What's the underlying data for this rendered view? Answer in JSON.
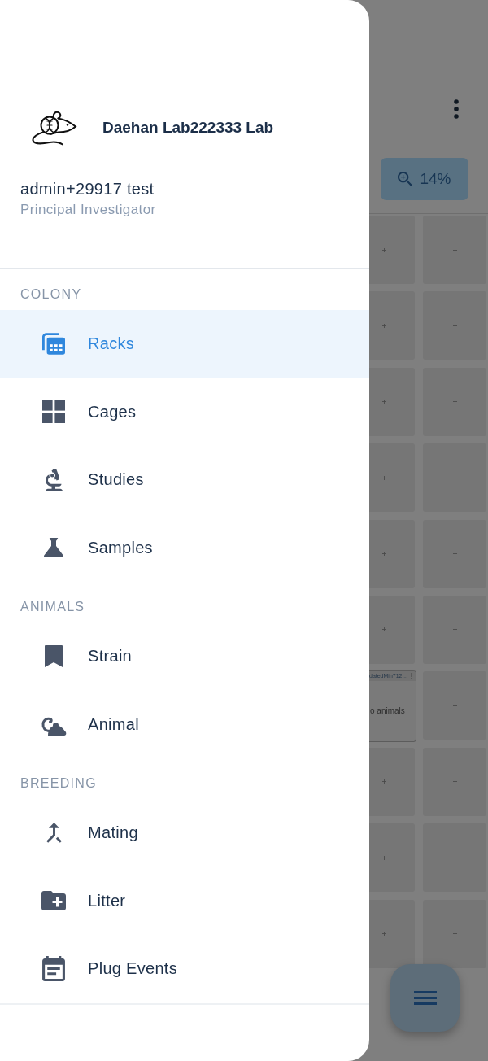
{
  "drawer": {
    "lab_name": "Daehan Lab222333 Lab",
    "user": {
      "name": "admin+29917 test",
      "role": "Principal Investigator"
    },
    "sections": [
      {
        "title": "COLONY",
        "items": [
          {
            "label": "Racks",
            "selected": true
          },
          {
            "label": "Cages",
            "selected": false
          },
          {
            "label": "Studies",
            "selected": false
          },
          {
            "label": "Samples",
            "selected": false
          }
        ]
      },
      {
        "title": "ANIMALS",
        "items": [
          {
            "label": "Strain",
            "selected": false
          },
          {
            "label": "Animal",
            "selected": false
          }
        ]
      },
      {
        "title": "BREEDING",
        "items": [
          {
            "label": "Mating",
            "selected": false
          },
          {
            "label": "Litter",
            "selected": false
          },
          {
            "label": "Plug Events",
            "selected": false
          }
        ]
      }
    ]
  },
  "background": {
    "zoom_button": {
      "label": "14%"
    },
    "rack_slots": [
      {
        "kind": "empty"
      },
      {
        "kind": "empty"
      },
      {
        "kind": "empty"
      },
      {
        "kind": "empty"
      },
      {
        "kind": "empty"
      },
      {
        "kind": "empty"
      },
      {
        "kind": "empty"
      },
      {
        "kind": "empty"
      },
      {
        "kind": "empty"
      },
      {
        "kind": "empty"
      },
      {
        "kind": "empty"
      },
      {
        "kind": "empty"
      },
      {
        "kind": "cage",
        "title": "datedMin712…",
        "text": "o animals"
      },
      {
        "kind": "empty"
      },
      {
        "kind": "empty"
      },
      {
        "kind": "empty"
      },
      {
        "kind": "empty"
      },
      {
        "kind": "empty"
      },
      {
        "kind": "empty"
      },
      {
        "kind": "empty"
      }
    ]
  }
}
